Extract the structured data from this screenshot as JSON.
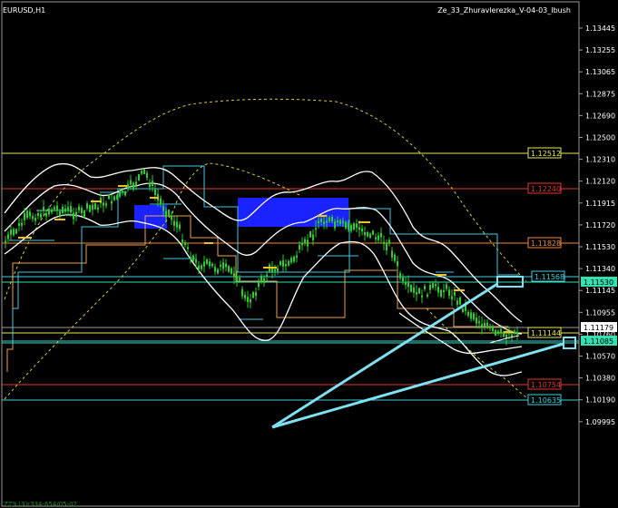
{
  "header": {
    "symbol": "EURUSD,H1",
    "indicator": "Ze_33_Zhuravlerezka_V-04-03_Ibush"
  },
  "footer": {
    "text": "ZZ9 (3)r334-654/05-02"
  },
  "price_axis": {
    "labels": [
      "1.13445",
      "1.13255",
      "1.13065",
      "1.12875",
      "1.12690",
      "1.12500",
      "1.12310",
      "1.12120",
      "1.11915",
      "1.11720",
      "1.11530",
      "1.11340",
      "1.11145",
      "1.10955",
      "1.10760",
      "1.10570",
      "1.10380",
      "1.10190",
      "1.09995"
    ],
    "current_price": "1.11179"
  },
  "levels": [
    {
      "name": "level-1-12512",
      "label": "1.12512",
      "color": "#e8e85a"
    },
    {
      "name": "level-1-12240",
      "label": "1.12240",
      "color": "#e03a2a"
    },
    {
      "name": "level-1-11828",
      "label": "1.11828",
      "color": "#f0883a"
    },
    {
      "name": "level-1-11568",
      "label": "1.11568",
      "color": "#40d0e0"
    },
    {
      "name": "level-1-11530",
      "label": "1.11530",
      "color": "#33e0b0"
    },
    {
      "name": "level-1-11144",
      "label": "1.11144",
      "color": "#e8e85a"
    },
    {
      "name": "level-1-11085",
      "label": "1.11085",
      "color": "#40d0e0"
    },
    {
      "name": "level-1-10754",
      "label": "1.10754",
      "color": "#e03a2a"
    },
    {
      "name": "level-1-10635",
      "label": "1.10635",
      "color": "#40d0e0"
    }
  ],
  "colors": {
    "background": "#000000",
    "candles": "#2ecc2e",
    "bands": "#ffffff",
    "arrows": "#7fe0f0",
    "zone": "#1a22ff"
  }
}
